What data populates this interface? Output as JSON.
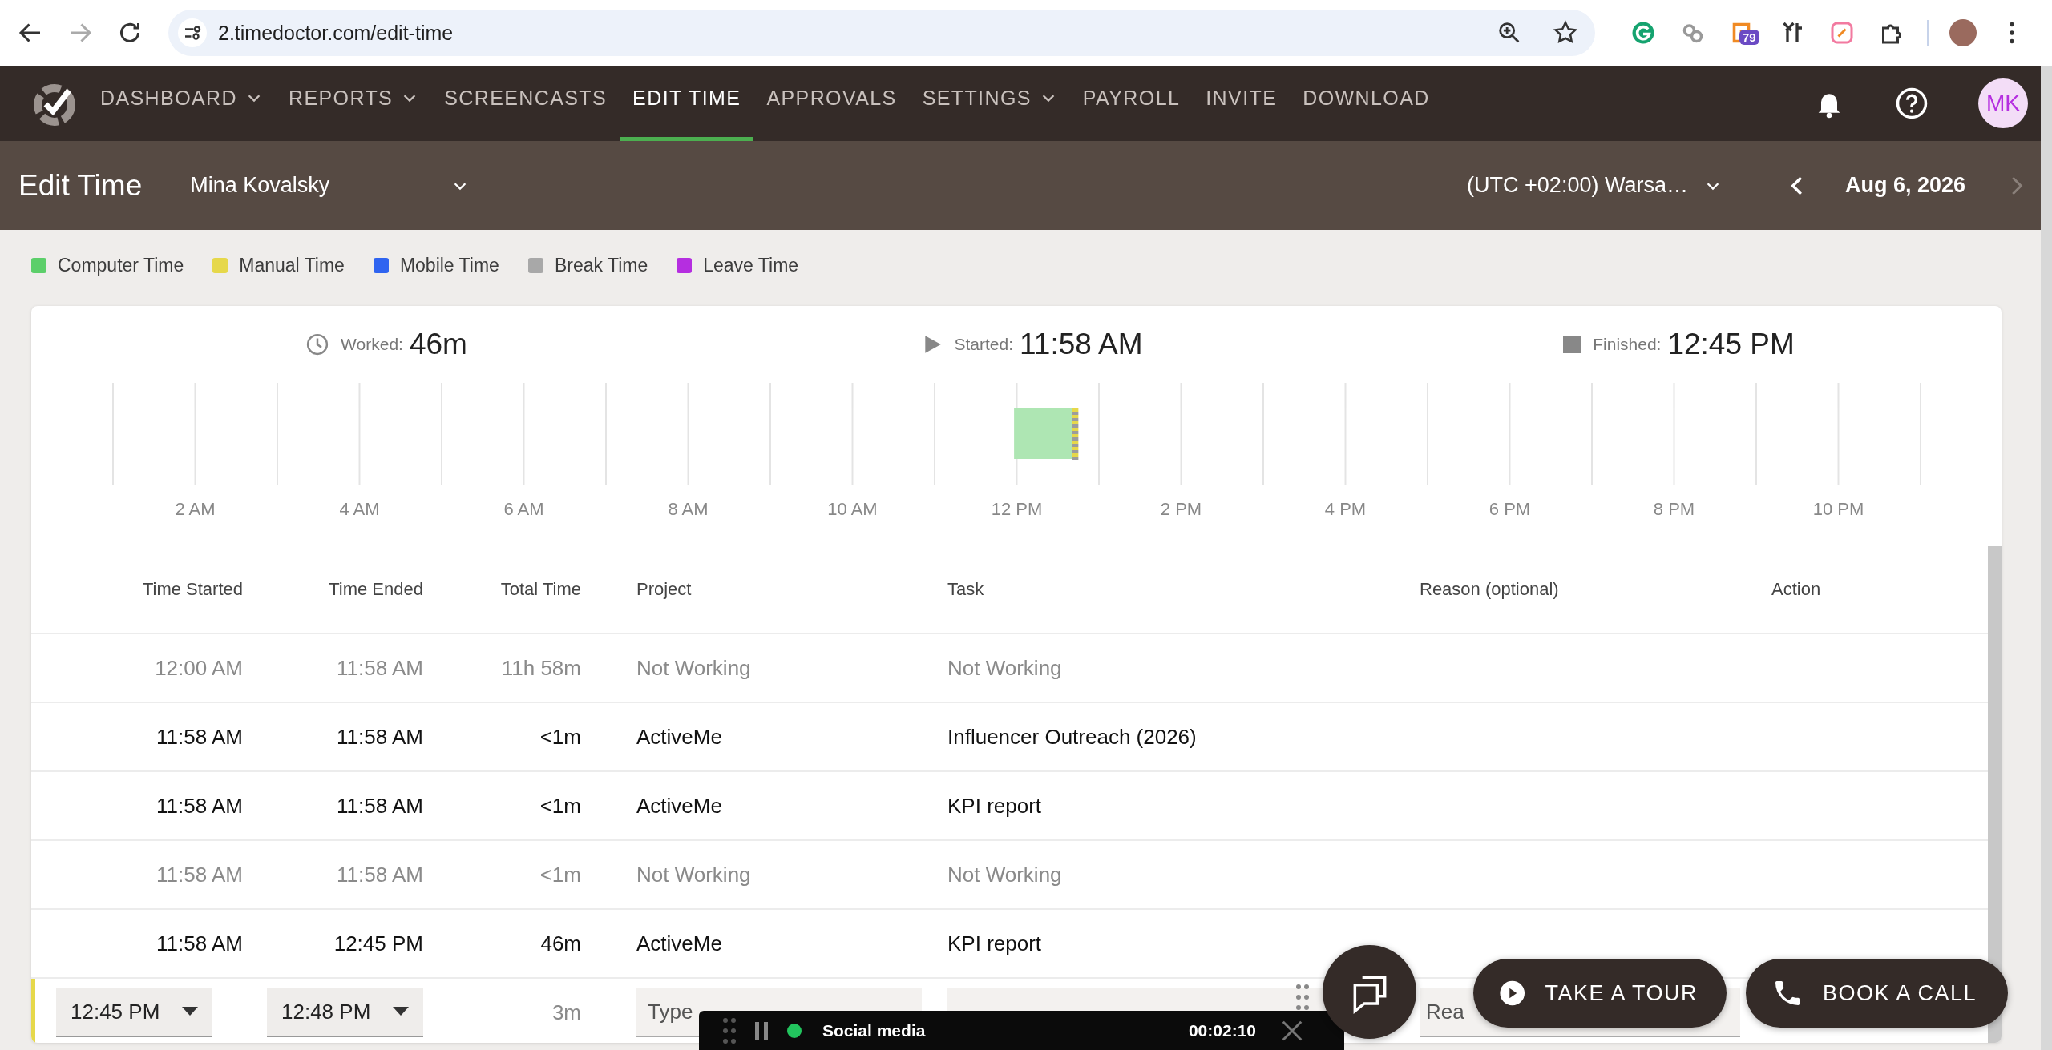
{
  "browser": {
    "url": "2.timedoctor.com/edit-time",
    "extension_badge": "79"
  },
  "nav": {
    "items": [
      {
        "label": "DASHBOARD",
        "dropdown": true,
        "selected": false
      },
      {
        "label": "REPORTS",
        "dropdown": true,
        "selected": false
      },
      {
        "label": "SCREENCASTS",
        "dropdown": false,
        "selected": false
      },
      {
        "label": "EDIT TIME",
        "dropdown": false,
        "selected": true
      },
      {
        "label": "APPROVALS",
        "dropdown": false,
        "selected": false
      },
      {
        "label": "SETTINGS",
        "dropdown": true,
        "selected": false
      },
      {
        "label": "PAYROLL",
        "dropdown": false,
        "selected": false
      },
      {
        "label": "INVITE",
        "dropdown": false,
        "selected": false
      },
      {
        "label": "DOWNLOAD",
        "dropdown": false,
        "selected": false
      }
    ],
    "avatar": "MK"
  },
  "header": {
    "title": "Edit Time",
    "user": "Mina Kovalsky",
    "timezone": "(UTC +02:00) Warsa…",
    "date": "Aug 6, 2026",
    "next_disabled": true
  },
  "legend": [
    {
      "label": "Computer Time",
      "color": "#5ccf6a"
    },
    {
      "label": "Manual Time",
      "color": "#e6d84a"
    },
    {
      "label": "Mobile Time",
      "color": "#2f64f0"
    },
    {
      "label": "Break Time",
      "color": "#a8a8a8"
    },
    {
      "label": "Leave Time",
      "color": "#b52ee0"
    }
  ],
  "summary": {
    "worked_label": "Worked:",
    "worked": "46m",
    "started_label": "Started:",
    "started": "11:58 AM",
    "finished_label": "Finished:",
    "finished": "12:45 PM"
  },
  "timeline": {
    "hour_labels": [
      "2 AM",
      "4 AM",
      "6 AM",
      "8 AM",
      "10 AM",
      "12 PM",
      "2 PM",
      "4 PM",
      "6 PM",
      "8 PM",
      "10 PM"
    ]
  },
  "table": {
    "columns": [
      "Time Started",
      "Time Ended",
      "Total Time",
      "Project",
      "Task",
      "Reason (optional)",
      "Action"
    ],
    "rows": [
      {
        "kind": "entry",
        "muted": true,
        "time_started": "12:00 AM",
        "time_ended": "11:58 AM",
        "total_time": "11h 58m",
        "project": "Not Working",
        "task": "Not Working"
      },
      {
        "kind": "entry",
        "muted": false,
        "time_started": "11:58 AM",
        "time_ended": "11:58 AM",
        "total_time": "<1m",
        "project": "ActiveMe",
        "task": "Influencer Outreach (2026)"
      },
      {
        "kind": "entry",
        "muted": false,
        "time_started": "11:58 AM",
        "time_ended": "11:58 AM",
        "total_time": "<1m",
        "project": "ActiveMe",
        "task": "KPI report"
      },
      {
        "kind": "entry",
        "muted": true,
        "time_started": "11:58 AM",
        "time_ended": "11:58 AM",
        "total_time": "<1m",
        "project": "Not Working",
        "task": "Not Working"
      },
      {
        "kind": "entry",
        "muted": false,
        "time_started": "11:58 AM",
        "time_ended": "12:45 PM",
        "total_time": "46m",
        "project": "ActiveMe",
        "task": "KPI report"
      },
      {
        "kind": "edit",
        "time_started": "12:45 PM",
        "time_ended": "12:48 PM",
        "total_time": "3m",
        "project_placeholder": "Type",
        "reason_placeholder": "Rea"
      }
    ]
  },
  "buttons": [
    {
      "kind": "tour",
      "label": "TAKE A TOUR"
    },
    {
      "kind": "call",
      "label": "BOOK A CALL"
    }
  ],
  "recorder": {
    "activity": "Social media",
    "elapsed": "00:02:10"
  }
}
